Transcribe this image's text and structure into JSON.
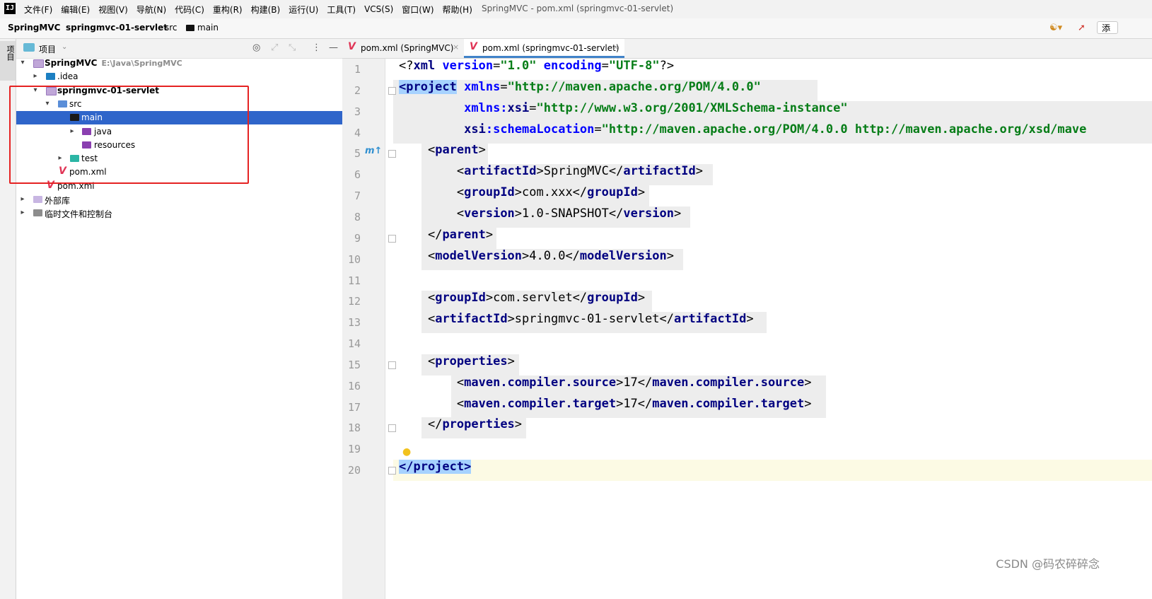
{
  "menubar": {
    "items": [
      "文件(F)",
      "编辑(E)",
      "视图(V)",
      "导航(N)",
      "代码(C)",
      "重构(R)",
      "构建(B)",
      "运行(U)",
      "工具(T)",
      "VCS(S)",
      "窗口(W)",
      "帮助(H)"
    ],
    "window_title": "SpringMVC - pom.xml (springmvc-01-servlet)"
  },
  "navbar": {
    "crumbs": [
      "SpringMVC",
      "springmvc-01-servlet",
      "src",
      "main"
    ],
    "add_label": "添"
  },
  "toolstrip": {
    "project_tab": "项目"
  },
  "project_panel": {
    "title": "项目",
    "tree": [
      {
        "label": "SpringMVC",
        "sub": "E:\\Java\\SpringMVC",
        "icon": "module-folder-icon"
      },
      {
        "label": ".idea",
        "icon": "idea-folder-icon"
      },
      {
        "label": "springmvc-01-servlet",
        "icon": "module-folder-icon"
      },
      {
        "label": "src",
        "icon": "source-folder-icon"
      },
      {
        "label": "main",
        "icon": "folder-icon"
      },
      {
        "label": "java",
        "icon": "java-source-folder-icon"
      },
      {
        "label": "resources",
        "icon": "resources-folder-icon"
      },
      {
        "label": "test",
        "icon": "test-folder-icon"
      },
      {
        "label": "pom.xml",
        "icon": "maven-file-icon"
      },
      {
        "label": "pom.xml",
        "icon": "maven-file-icon"
      },
      {
        "label": "外部库",
        "icon": "external-libraries-icon"
      },
      {
        "label": "临时文件和控制台",
        "icon": "scratches-icon"
      }
    ]
  },
  "tabs": [
    {
      "label": "pom.xml (SpringMVC)",
      "active": false
    },
    {
      "label": "pom.xml (springmvc-01-servlet)",
      "active": true
    }
  ],
  "editor": {
    "line_numbers": [
      "1",
      "2",
      "3",
      "4",
      "5",
      "6",
      "7",
      "8",
      "9",
      "10",
      "11",
      "12",
      "13",
      "14",
      "15",
      "16",
      "17",
      "18",
      "19",
      "20"
    ],
    "lines": [
      {
        "indent": "",
        "parts": [
          [
            "t",
            "<?"
          ],
          [
            "k",
            "xml "
          ],
          [
            "a",
            "version"
          ],
          [
            "t",
            "="
          ],
          [
            "s",
            "\"1.0\""
          ],
          [
            "t",
            " "
          ],
          [
            "a",
            "encoding"
          ],
          [
            "t",
            "="
          ],
          [
            "s",
            "\"UTF-8\""
          ],
          [
            "t",
            "?>"
          ]
        ]
      },
      {
        "indent": "",
        "parts": [
          [
            "tagk",
            "<project"
          ],
          [
            "t",
            " "
          ],
          [
            "a",
            "xmlns"
          ],
          [
            "t",
            "="
          ],
          [
            "s",
            "\"http://maven.apache.org/POM/4.0.0\""
          ]
        ]
      },
      {
        "indent": "         ",
        "parts": [
          [
            "a",
            "xmlns:"
          ],
          [
            "k",
            "xsi"
          ],
          [
            "t",
            "="
          ],
          [
            "s",
            "\"http://www.w3.org/2001/XMLSchema-instance\""
          ]
        ]
      },
      {
        "indent": "         ",
        "parts": [
          [
            "k",
            "xsi"
          ],
          [
            "a",
            ":schemaLocation"
          ],
          [
            "t",
            "="
          ],
          [
            "s",
            "\"http://maven.apache.org/POM/4.0.0 http://maven.apache.org/xsd/mave"
          ]
        ]
      },
      {
        "indent": "    ",
        "parts": [
          [
            "t",
            "<"
          ],
          [
            "k",
            "parent"
          ],
          [
            "t",
            ">"
          ]
        ]
      },
      {
        "indent": "        ",
        "parts": [
          [
            "t",
            "<"
          ],
          [
            "k",
            "artifactId"
          ],
          [
            "t",
            ">SpringMVC</"
          ],
          [
            "k",
            "artifactId"
          ],
          [
            "t",
            ">"
          ]
        ]
      },
      {
        "indent": "        ",
        "parts": [
          [
            "t",
            "<"
          ],
          [
            "k",
            "groupId"
          ],
          [
            "t",
            ">com.xxx</"
          ],
          [
            "k",
            "groupId"
          ],
          [
            "t",
            ">"
          ]
        ]
      },
      {
        "indent": "        ",
        "parts": [
          [
            "t",
            "<"
          ],
          [
            "k",
            "version"
          ],
          [
            "t",
            ">1.0-SNAPSHOT</"
          ],
          [
            "k",
            "version"
          ],
          [
            "t",
            ">"
          ]
        ]
      },
      {
        "indent": "    ",
        "parts": [
          [
            "t",
            "</"
          ],
          [
            "k",
            "parent"
          ],
          [
            "t",
            ">"
          ]
        ]
      },
      {
        "indent": "    ",
        "parts": [
          [
            "t",
            "<"
          ],
          [
            "k",
            "modelVersion"
          ],
          [
            "t",
            ">4.0.0</"
          ],
          [
            "k",
            "modelVersion"
          ],
          [
            "t",
            ">"
          ]
        ]
      },
      {
        "indent": "",
        "parts": []
      },
      {
        "indent": "    ",
        "parts": [
          [
            "t",
            "<"
          ],
          [
            "k",
            "groupId"
          ],
          [
            "t",
            ">com.servlet</"
          ],
          [
            "k",
            "groupId"
          ],
          [
            "t",
            ">"
          ]
        ]
      },
      {
        "indent": "    ",
        "parts": [
          [
            "t",
            "<"
          ],
          [
            "k",
            "artifactId"
          ],
          [
            "t",
            ">springmvc-01-servlet</"
          ],
          [
            "k",
            "artifactId"
          ],
          [
            "t",
            ">"
          ]
        ]
      },
      {
        "indent": "",
        "parts": []
      },
      {
        "indent": "    ",
        "parts": [
          [
            "t",
            "<"
          ],
          [
            "k",
            "properties"
          ],
          [
            "t",
            ">"
          ]
        ]
      },
      {
        "indent": "        ",
        "parts": [
          [
            "t",
            "<"
          ],
          [
            "k",
            "maven.compiler.source"
          ],
          [
            "t",
            ">17</"
          ],
          [
            "k",
            "maven.compiler.source"
          ],
          [
            "t",
            ">"
          ]
        ]
      },
      {
        "indent": "        ",
        "parts": [
          [
            "t",
            "<"
          ],
          [
            "k",
            "maven.compiler.target"
          ],
          [
            "t",
            ">17</"
          ],
          [
            "k",
            "maven.compiler.target"
          ],
          [
            "t",
            ">"
          ]
        ]
      },
      {
        "indent": "    ",
        "parts": [
          [
            "t",
            "</"
          ],
          [
            "k",
            "properties"
          ],
          [
            "t",
            ">"
          ]
        ]
      },
      {
        "indent": "",
        "parts": []
      },
      {
        "indent": "",
        "parts": [
          [
            "tagk",
            "</project>"
          ]
        ]
      }
    ],
    "gutter_marker": "m↑"
  },
  "watermark": "CSDN @码农碎碎念"
}
